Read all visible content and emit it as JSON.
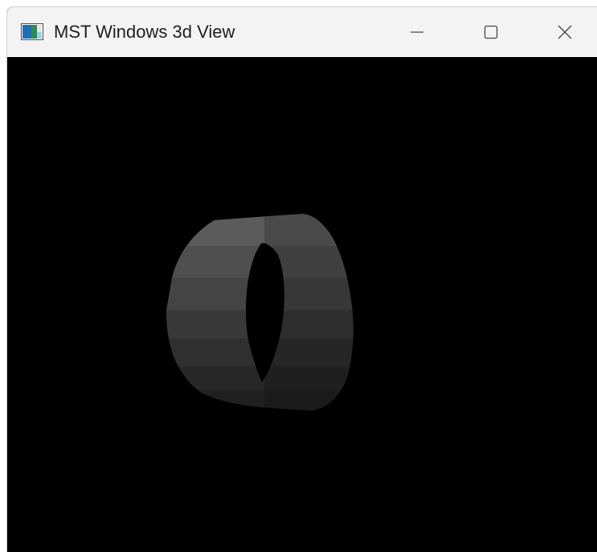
{
  "window": {
    "title": "MST Windows 3d View"
  },
  "titlebar": {
    "app_icon": "app-window-icon",
    "minimize_icon": "minimize-icon",
    "maximize_icon": "maximize-icon",
    "close_icon": "close-icon"
  },
  "viewport": {
    "background": "#000000",
    "object": "ring-3d",
    "shading_colors": [
      "#5a5a5a",
      "#4e4e4e",
      "#444444",
      "#3a3a3a",
      "#303030",
      "#272727",
      "#202020"
    ]
  }
}
